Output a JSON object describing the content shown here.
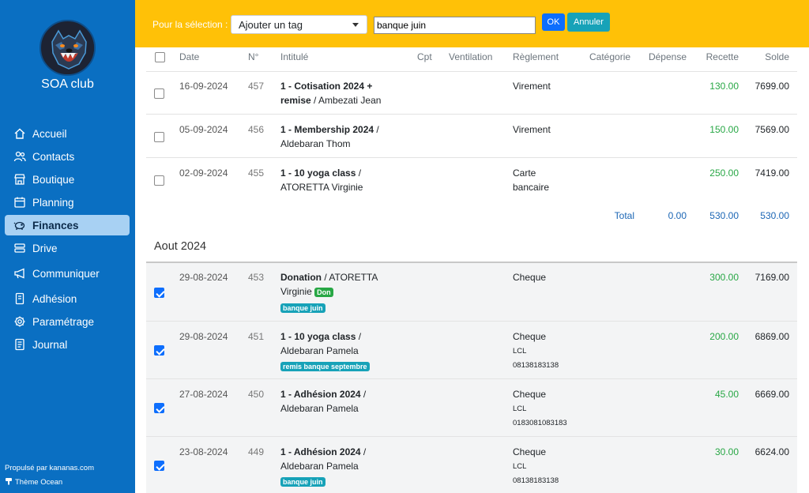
{
  "app": {
    "name": "SOA club"
  },
  "nav": [
    {
      "label": "Accueil",
      "icon": "home-icon"
    },
    {
      "label": "Contacts",
      "icon": "users-icon"
    },
    {
      "label": "Boutique",
      "icon": "shop-icon"
    },
    {
      "label": "Planning",
      "icon": "calendar-icon"
    },
    {
      "label": "Finances",
      "icon": "piggy-bank-icon",
      "active": true
    },
    {
      "label": "Drive",
      "icon": "drive-icon"
    },
    {
      "label": "Communiquer",
      "icon": "megaphone-icon"
    },
    {
      "label": "Adhésion",
      "icon": "member-card-icon"
    },
    {
      "label": "Paramétrage",
      "icon": "gear-icon"
    },
    {
      "label": "Journal",
      "icon": "journal-icon"
    }
  ],
  "footer": {
    "powered": "Propulsé par kananas.com",
    "theme": "Thème Ocean"
  },
  "toolbar": {
    "selection_label": "Pour la sélection :",
    "tag_select": "Ajouter un tag",
    "tag_input": "banque juin",
    "ok": "OK",
    "cancel": "Annuler"
  },
  "columns": {
    "date": "Date",
    "num": "N°",
    "title": "Intitulé",
    "cpt": "Cpt",
    "ventilation": "Ventilation",
    "reglement": "Règlement",
    "categorie": "Catégorie",
    "depense": "Dépense",
    "recette": "Recette",
    "solde": "Solde"
  },
  "rows_sept": [
    {
      "date": "16-09-2024",
      "num": "457",
      "title": "1 - Cotisation 2024 +",
      "title2": "remise",
      "person": " / Ambezati Jean",
      "reglement": "Virement",
      "recette": "130.00",
      "solde": "7699.00"
    },
    {
      "date": "05-09-2024",
      "num": "456",
      "title": "1 - Membership 2024",
      "sep": " /",
      "person": "Aldebaran Thom",
      "reglement": "Virement",
      "recette": "150.00",
      "solde": "7569.00"
    },
    {
      "date": "02-09-2024",
      "num": "455",
      "title": "1 - 10 yoga class",
      "sep": " /",
      "person": "ATORETTA Virginie",
      "reglement": "Carte",
      "reglement2": "bancaire",
      "recette": "250.00",
      "solde": "7419.00"
    }
  ],
  "total": {
    "label": "Total",
    "depense": "0.00",
    "recette": "530.00",
    "solde": "530.00"
  },
  "month": "Aout 2024",
  "rows_aug": [
    {
      "date": "29-08-2024",
      "num": "453",
      "title": "Donation",
      "person_a": " / ATORETTA",
      "person_b": "Virginie",
      "badge_inline": "Don",
      "badge": "banque juin",
      "reglement": "Cheque",
      "recette": "300.00",
      "solde": "7169.00"
    },
    {
      "date": "29-08-2024",
      "num": "451",
      "title": "1 - 10 yoga class",
      "sep": " /",
      "person": "Aldebaran Pamela",
      "badge": "remis banque septembre",
      "reglement": "Cheque",
      "bank": "LCL",
      "account": "08138183138",
      "recette": "200.00",
      "solde": "6869.00"
    },
    {
      "date": "27-08-2024",
      "num": "450",
      "title": "1 - Adhésion 2024",
      "sep": " /",
      "person": "Aldebaran Pamela",
      "reglement": "Cheque",
      "bank": "LCL",
      "account": "0183081083183",
      "recette": "45.00",
      "solde": "6669.00"
    },
    {
      "date": "23-08-2024",
      "num": "449",
      "title": "1 - Adhésion 2024",
      "sep": " /",
      "person": "Aldebaran Pamela",
      "badge": "banque juin",
      "reglement": "Cheque",
      "bank": "LCL",
      "account": "08138183138",
      "recette": "30.00",
      "solde": "6624.00"
    }
  ],
  "colors": {
    "sidebar": "#0a6fc2",
    "topbar": "#ffc107",
    "income": "#28a745",
    "total": "#1b66b5",
    "badge": "#17a2b8"
  }
}
